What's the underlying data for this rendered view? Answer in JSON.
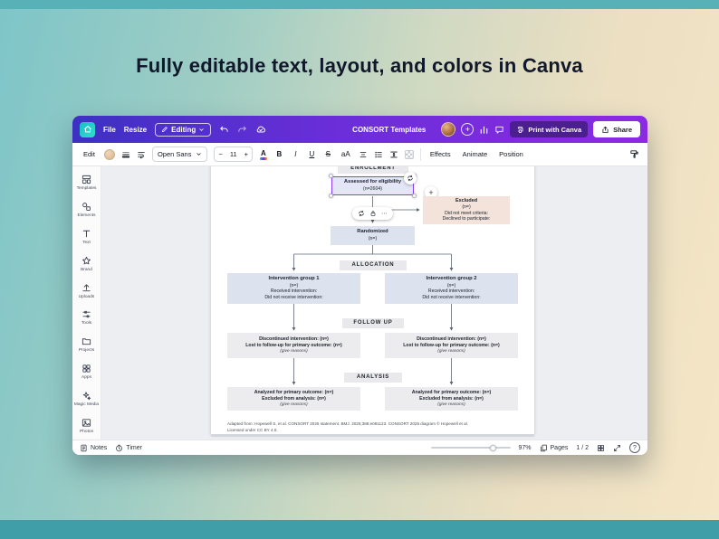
{
  "page": {
    "headline": "Fully editable text, layout, and colors in Canva"
  },
  "header": {
    "file": "File",
    "resize": "Resize",
    "editing": "Editing",
    "title": "CONSORT Templates",
    "print": "Print with Canva",
    "share": "Share"
  },
  "toolbar": {
    "edit": "Edit",
    "font": "Open Sans",
    "size": "11",
    "minus": "−",
    "plus": "+",
    "text_color": "A",
    "bold": "B",
    "italic": "I",
    "underline": "U",
    "strike": "S",
    "case": "aA",
    "effects": "Effects",
    "animate": "Animate",
    "position": "Position"
  },
  "sidebar": {
    "items": [
      {
        "label": "Templates",
        "icon": "templates-icon"
      },
      {
        "label": "Elements",
        "icon": "elements-icon"
      },
      {
        "label": "Text",
        "icon": "text-icon"
      },
      {
        "label": "Brand",
        "icon": "brand-icon"
      },
      {
        "label": "Uploads",
        "icon": "uploads-icon"
      },
      {
        "label": "Tools",
        "icon": "tools-icon"
      },
      {
        "label": "Projects",
        "icon": "projects-icon"
      },
      {
        "label": "Apps",
        "icon": "apps-icon"
      },
      {
        "label": "Magic Media",
        "icon": "magic-media-icon"
      },
      {
        "label": "Photos",
        "icon": "photos-icon"
      }
    ]
  },
  "status": {
    "notes": "Notes",
    "timer": "Timer",
    "zoom": "97%",
    "pages": "Pages",
    "indicator": "1 / 2",
    "help": "?"
  },
  "diagram": {
    "phases": {
      "enrollment": "ENROLLMENT",
      "allocation": "ALLOCATION",
      "followup": "FOLLOW UP",
      "analysis": "ANALYSIS"
    },
    "assessed": {
      "title": "Assessed for eligibility",
      "n": "(n=2604)"
    },
    "excluded": {
      "title": "Excluded",
      "n": "(n=)",
      "line1": "Did not meet criteria:",
      "line2": "Declined to participate:"
    },
    "randomized": {
      "title": "Randomized",
      "n": "(n=)"
    },
    "group1": {
      "title": "Intervention group 1",
      "n": "(n=)",
      "line1": "Received intervention:",
      "line2": "Did not receive intervention:"
    },
    "group2": {
      "title": "Intervention group 2",
      "n": "(n=)",
      "line1": "Received intervention:",
      "line2": "Did not receive intervention:"
    },
    "followup1": {
      "line1": "Discontinued intervention: (n=)",
      "line2": "Lost to follow-up for primary outcome: (n=)",
      "line3": "(give reasons)"
    },
    "followup2": {
      "line1": "Discontinued intervention: (n=)",
      "line2": "Lost to follow-up for primary outcome: (n=)",
      "line3": "(give reasons)"
    },
    "analysis1": {
      "line1": "Analyzed for primary outcome: (n=)",
      "line2": "Excluded from analysis: (n=)",
      "line3": "(give reasons)"
    },
    "analysis2": {
      "line1": "Analyzed for primary outcome: (n=)",
      "line2": "Excluded from analysis: (n=)",
      "line3": "(give reasons)"
    },
    "footnote_line1": "Adapted from: Hopewell S, et al. CONSORT 2025 statement. BMJ. 2025;388:e081123. CONSORT 2025 diagram © Hopewell et al.",
    "footnote_line2": "Licensed under CC BY 4.0."
  },
  "icons": {
    "plus": "+",
    "minus": "−",
    "more": "⋯",
    "help": "?"
  },
  "colors": {
    "canva_purple": "#8b3dff",
    "header_gradient_start": "#3d31c2",
    "header_gradient_end": "#8a2be2",
    "teal_strip_top": "#58b1b7",
    "teal_strip_bottom": "#3f9ea8",
    "selection": "#8b3dff",
    "box_blue": "#dce3ee",
    "box_pink": "#f4e3da",
    "box_gray": "#ececee",
    "phase_gray": "#e9e9eb",
    "connector": "#5d6673"
  }
}
